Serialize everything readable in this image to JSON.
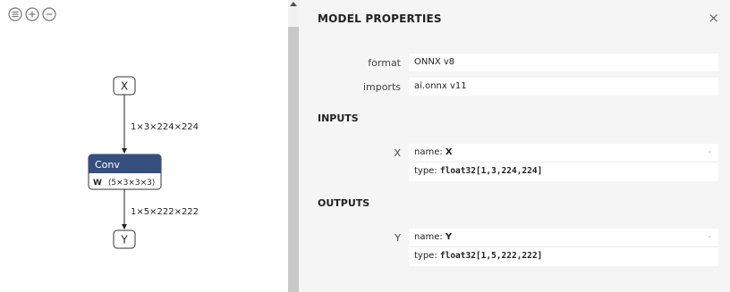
{
  "graph": {
    "toolbar": {
      "menu_icon": "menu-icon",
      "zoom_in_icon": "zoom-in-icon",
      "zoom_out_icon": "zoom-out-icon"
    },
    "input_node": "X",
    "output_node": "Y",
    "conv_node": {
      "title": "Conv",
      "attr_name": "W",
      "attr_value": "⟨5×3×3×3⟩"
    },
    "edge_in_label": "1×3×224×224",
    "edge_out_label": "1×5×222×222"
  },
  "sidebar": {
    "title": "MODEL PROPERTIES",
    "close_icon": "×",
    "properties": [
      {
        "label": "format",
        "value": "ONNX v8"
      },
      {
        "label": "imports",
        "value": "ai.onnx v11"
      }
    ],
    "inputs_title": "INPUTS",
    "input": {
      "label": "X",
      "name_prefix": "name: ",
      "name": "X",
      "type_prefix": "type: ",
      "type": "float32[1,3,224,224]",
      "toggle": "-"
    },
    "outputs_title": "OUTPUTS",
    "output": {
      "label": "Y",
      "name_prefix": "name: ",
      "name": "Y",
      "type_prefix": "type: ",
      "type": "float32[1,5,222,222]",
      "toggle": "-"
    }
  }
}
